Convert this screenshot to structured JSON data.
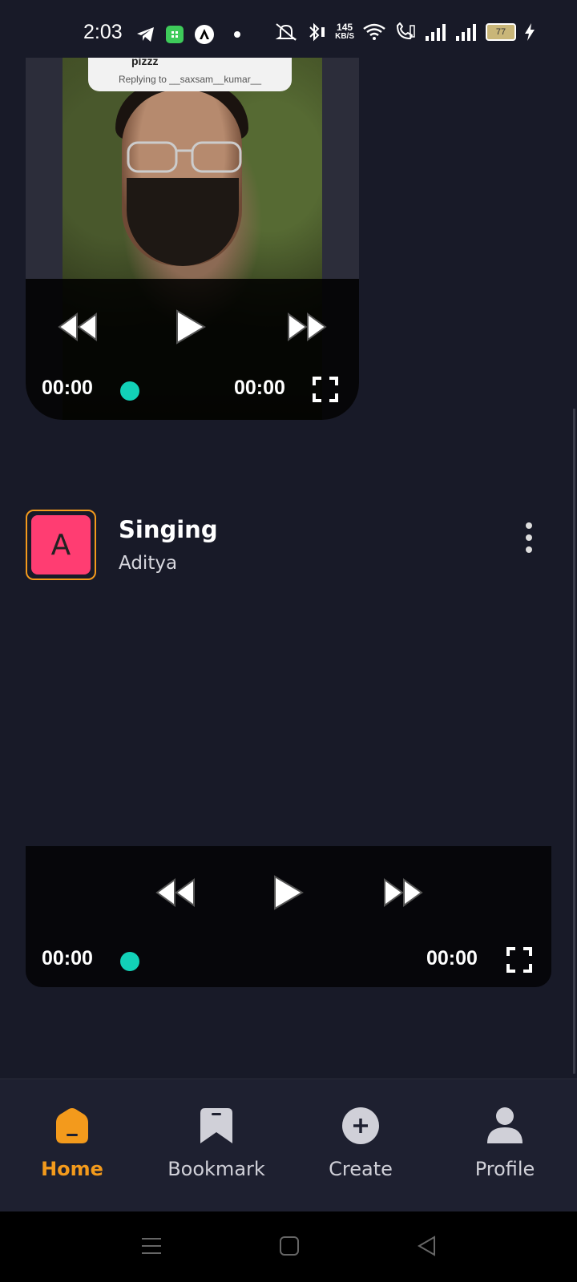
{
  "status_bar": {
    "time": "2:03",
    "net_speed_value": "145",
    "net_speed_unit": "KB/S",
    "battery": "77",
    "icons": [
      "telegram-icon",
      "shopping-bag-icon",
      "app-a-icon",
      "dot-icon",
      "mute-icon",
      "bluetooth-icon",
      "wifi-icon",
      "call-icon",
      "signal-icon",
      "signal-icon",
      "battery-icon",
      "charging-icon"
    ]
  },
  "video1": {
    "reply_top": "pizzz",
    "reply_text": "Replying to __saxsam__kumar__",
    "current_time": "00:00",
    "duration": "00:00"
  },
  "post": {
    "avatar_letter": "A",
    "title": "Singing",
    "author": "Aditya"
  },
  "video2": {
    "current_time": "00:00",
    "duration": "00:00"
  },
  "nav": {
    "items": [
      {
        "label": "Home",
        "active": true
      },
      {
        "label": "Bookmark",
        "active": false
      },
      {
        "label": "Create",
        "active": false
      },
      {
        "label": "Profile",
        "active": false
      }
    ]
  },
  "colors": {
    "background": "#181a28",
    "accent": "#f39a1c",
    "seek": "#12d1b8",
    "avatar_bg": "#ff3d72"
  }
}
